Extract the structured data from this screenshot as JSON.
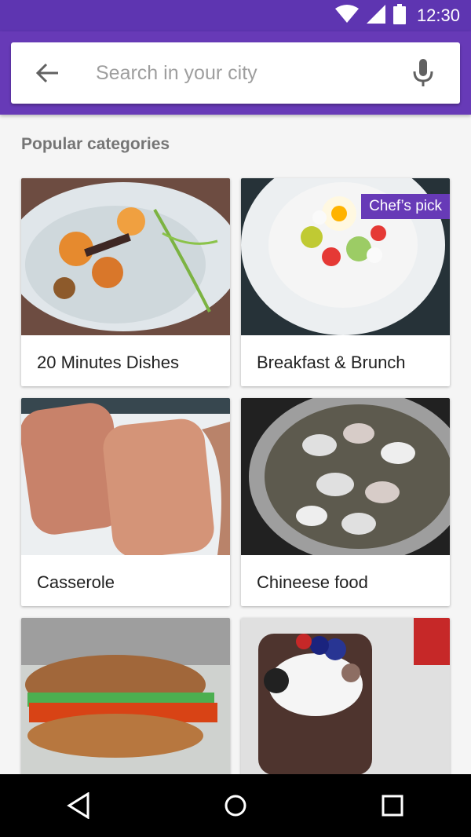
{
  "status_bar": {
    "time": "12:30"
  },
  "search": {
    "placeholder": "Search in your city"
  },
  "section": {
    "title": "Popular categories"
  },
  "categories": [
    {
      "label": "20 Minutes Dishes"
    },
    {
      "label": "Breakfast & Brunch",
      "badge": "Chef’s pick"
    },
    {
      "label": "Casserole"
    },
    {
      "label": "Chineese food"
    },
    {
      "label": ""
    },
    {
      "label": ""
    }
  ],
  "icons": {
    "back": "arrow-back-icon",
    "mic": "mic-icon",
    "wifi": "wifi-icon",
    "signal": "signal-icon",
    "battery": "battery-icon",
    "nav_back": "nav-back-icon",
    "nav_home": "nav-home-icon",
    "nav_recents": "nav-recents-icon"
  },
  "colors": {
    "primary": "#673ab7",
    "primary_dark": "#5e35b1",
    "background": "#f5f5f5"
  }
}
